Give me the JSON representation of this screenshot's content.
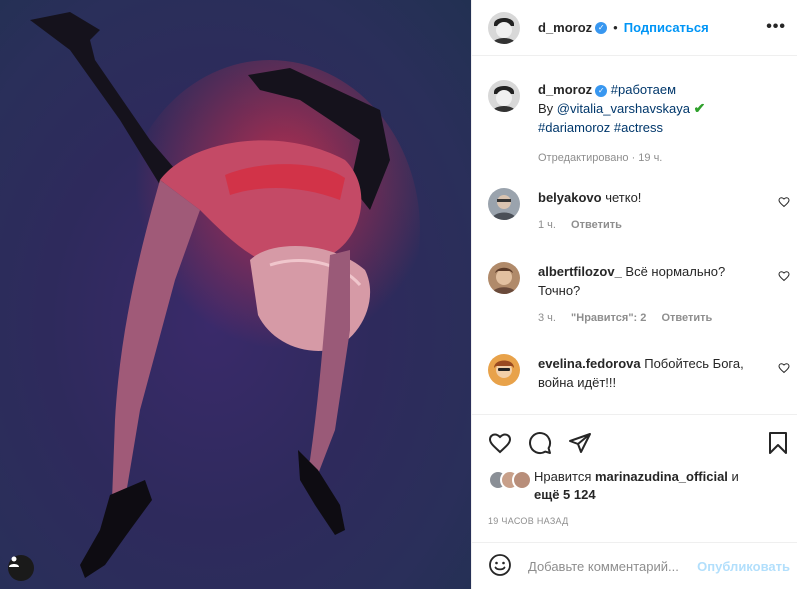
{
  "post": {
    "username": "d_moroz",
    "follow_label": "Подписаться",
    "dot": "•",
    "more_label": "•••"
  },
  "caption": {
    "username": "d_moroz",
    "hashtag1": "#работаем",
    "by_prefix": "By",
    "mention": "@vitalia_varshavskaya",
    "check": "✔",
    "hashtag2": "#dariamoroz",
    "hashtag3": "#actress",
    "meta": "Отредактировано · 19 ч."
  },
  "comments": [
    {
      "username": "belyakovo",
      "text": "четко!",
      "time": "1 ч.",
      "likes": "",
      "reply": "Ответить"
    },
    {
      "username": "albertfilozov_",
      "text": "Всё нормально? Точно?",
      "time": "3 ч.",
      "likes": "\"Нравится\": 2",
      "reply": "Ответить"
    },
    {
      "username": "evelina.fedorova",
      "text": "Побойтесь Бога, война идёт!!!"
    }
  ],
  "likes": {
    "prefix": "Нравится",
    "user": "marinazudina_official",
    "and": "и",
    "rest": "ещё 5 124"
  },
  "timestamp": "19 ЧАСОВ НАЗАД",
  "add_comment": {
    "placeholder": "Добавьте комментарий...",
    "post_label": "Опубликовать"
  },
  "colors": {
    "accent": "#0095f6",
    "verified": "#3897f0",
    "link": "#00376b"
  }
}
